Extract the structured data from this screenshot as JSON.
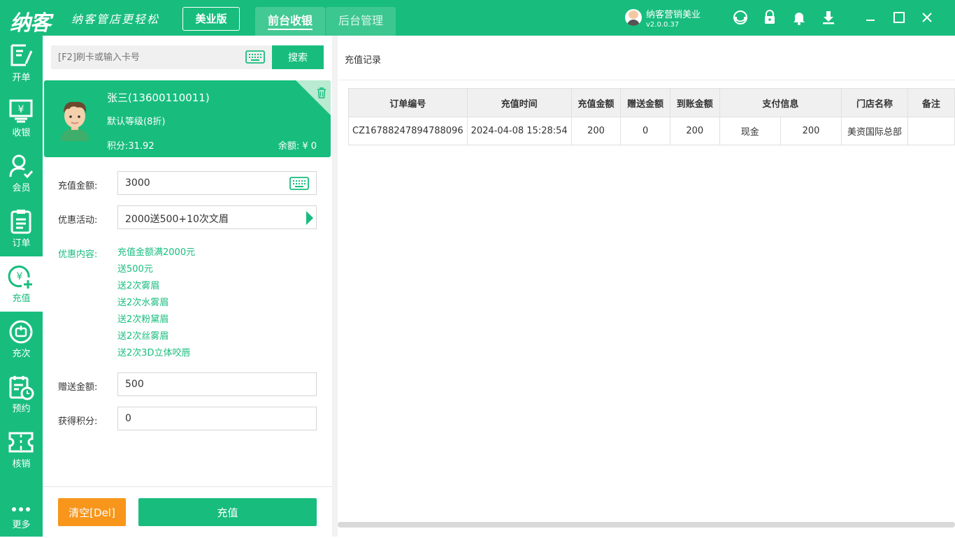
{
  "app": {
    "logo": "纳客",
    "slogan": "纳客管店更轻松",
    "edition": "美业版",
    "tabs": [
      {
        "label": "前台收银",
        "active": true
      },
      {
        "label": "后台管理",
        "active": false
      }
    ],
    "user_name": "纳客营销美业",
    "version": "v2.0.0.37",
    "top_icons": [
      "headset-icon",
      "lock-icon",
      "bell-icon",
      "download-icon"
    ],
    "window_buttons": [
      "minimize",
      "maximize",
      "close"
    ],
    "accent": "#18bd7e",
    "orange": "#f7961b"
  },
  "sidebar": {
    "items": [
      {
        "label": "开单",
        "icon": "edit-icon"
      },
      {
        "label": "收银",
        "icon": "cashier-icon"
      },
      {
        "label": "会员",
        "icon": "member-icon"
      },
      {
        "label": "订单",
        "icon": "clipboard-icon"
      },
      {
        "label": "充值",
        "icon": "recharge-icon",
        "active": true
      },
      {
        "label": "充次",
        "icon": "count-icon"
      },
      {
        "label": "预约",
        "icon": "calendar-icon"
      },
      {
        "label": "核销",
        "icon": "ticket-icon"
      }
    ],
    "more": {
      "label": "更多",
      "icon": "more-icon"
    }
  },
  "search": {
    "placeholder": "[F2]刷卡或输入卡号",
    "button": "搜索"
  },
  "member": {
    "name": "张三(13600110011)",
    "level": "默认等级(8折)",
    "points": "积分:31.92",
    "balance": "余额: ¥ 0"
  },
  "form": {
    "amount_label": "充值金额:",
    "amount_value": "3000",
    "promo_label": "优惠活动:",
    "promo_value": "2000送500+10次文眉",
    "promo_content_label": "优惠内容:",
    "promo_content": [
      "充值金额满2000元",
      "送500元",
      "送2次雾眉",
      "送2次水雾眉",
      "送2次粉黛眉",
      "送2次丝雾眉",
      "送2次3D立体咬唇"
    ],
    "gift_label": "赠送金额:",
    "gift_value": "500",
    "points_label": "获得积分:",
    "points_value": "0"
  },
  "actions": {
    "clear": "清空[Del]",
    "recharge": "充值"
  },
  "records": {
    "title": "充值记录",
    "columns": [
      "订单编号",
      "充值时间",
      "充值金额",
      "赠送金额",
      "到账金额",
      "支付信息",
      "门店名称",
      "备注"
    ],
    "rows": [
      {
        "order_no": "CZ16788247894788096",
        "time": "2024-04-08 15:28:54",
        "amount": "200",
        "gift": "0",
        "received": "200",
        "pay_method": "现金",
        "pay_amount": "200",
        "store": "美资国际总部",
        "remark": ""
      }
    ]
  }
}
